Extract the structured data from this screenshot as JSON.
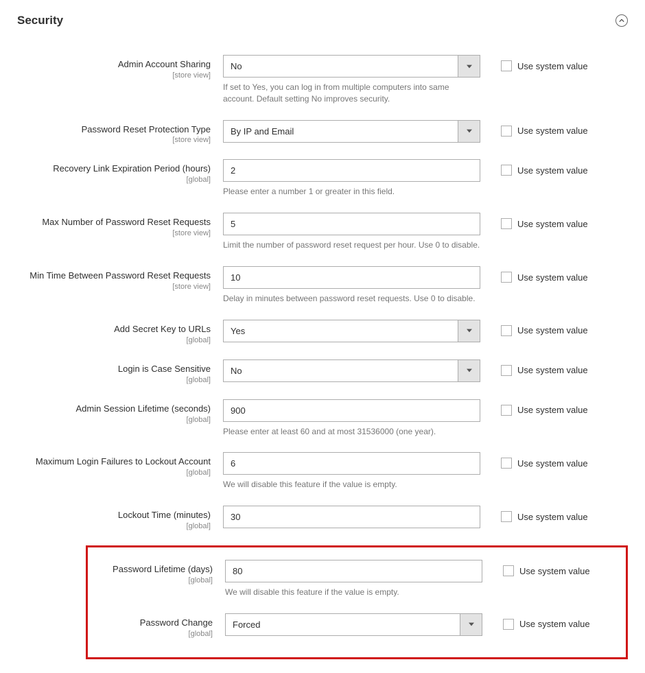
{
  "section": {
    "title": "Security"
  },
  "system_value_label": "Use system value",
  "scopes": {
    "store_view": "[store view]",
    "global": "[global]"
  },
  "fields": {
    "admin_account_sharing": {
      "label": "Admin Account Sharing",
      "value": "No",
      "note": "If set to Yes, you can log in from multiple computers into same account. Default setting No improves security."
    },
    "password_reset_protection": {
      "label": "Password Reset Protection Type",
      "value": "By IP and Email"
    },
    "recovery_link_expiration": {
      "label": "Recovery Link Expiration Period (hours)",
      "value": "2",
      "note": "Please enter a number 1 or greater in this field."
    },
    "max_password_reset": {
      "label": "Max Number of Password Reset Requests",
      "value": "5",
      "note": "Limit the number of password reset request per hour. Use 0 to disable."
    },
    "min_time_between": {
      "label": "Min Time Between Password Reset Requests",
      "value": "10",
      "note": "Delay in minutes between password reset requests. Use 0 to disable."
    },
    "add_secret_key": {
      "label": "Add Secret Key to URLs",
      "value": "Yes"
    },
    "login_case_sensitive": {
      "label": "Login is Case Sensitive",
      "value": "No"
    },
    "session_lifetime": {
      "label": "Admin Session Lifetime (seconds)",
      "value": "900",
      "note": "Please enter at least 60 and at most 31536000 (one year)."
    },
    "max_login_failures": {
      "label": "Maximum Login Failures to Lockout Account",
      "value": "6",
      "note": "We will disable this feature if the value is empty."
    },
    "lockout_time": {
      "label": "Lockout Time (minutes)",
      "value": "30"
    },
    "password_lifetime": {
      "label": "Password Lifetime (days)",
      "value": "80",
      "note": "We will disable this feature if the value is empty."
    },
    "password_change": {
      "label": "Password Change",
      "value": "Forced"
    }
  }
}
